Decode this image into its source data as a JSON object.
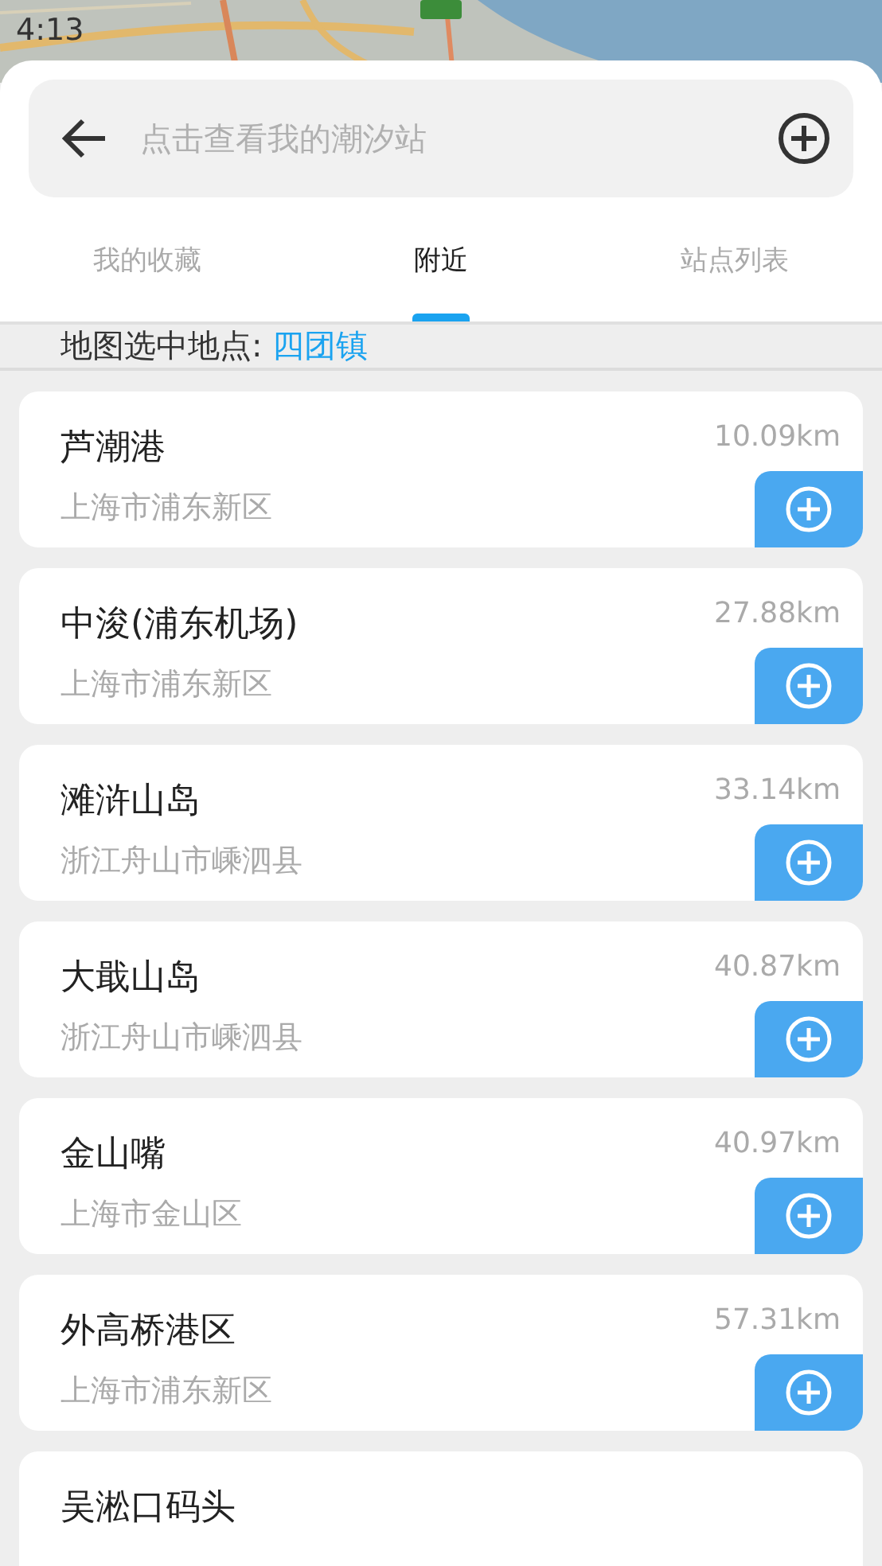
{
  "status_bar": {
    "time": "4:13"
  },
  "search": {
    "placeholder": "点击查看我的潮汐站"
  },
  "tabs": [
    {
      "label": "我的收藏",
      "selected": false
    },
    {
      "label": "附近",
      "selected": true
    },
    {
      "label": "站点列表",
      "selected": false
    }
  ],
  "selected_place": {
    "label": "地图选中地点:",
    "value": "四团镇"
  },
  "stations": [
    {
      "name": "芦潮港",
      "address": "上海市浦东新区",
      "distance": "10.09km"
    },
    {
      "name": "中浚(浦东机场)",
      "address": "上海市浦东新区",
      "distance": "27.88km"
    },
    {
      "name": "滩浒山岛",
      "address": "浙江舟山市嵊泗县",
      "distance": "33.14km"
    },
    {
      "name": "大戢山岛",
      "address": "浙江舟山市嵊泗县",
      "distance": "40.87km"
    },
    {
      "name": "金山嘴",
      "address": "上海市金山区",
      "distance": "40.97km"
    },
    {
      "name": "外高桥港区",
      "address": "上海市浦东新区",
      "distance": "57.31km"
    },
    {
      "name": "吴淞口码头"
    }
  ]
}
